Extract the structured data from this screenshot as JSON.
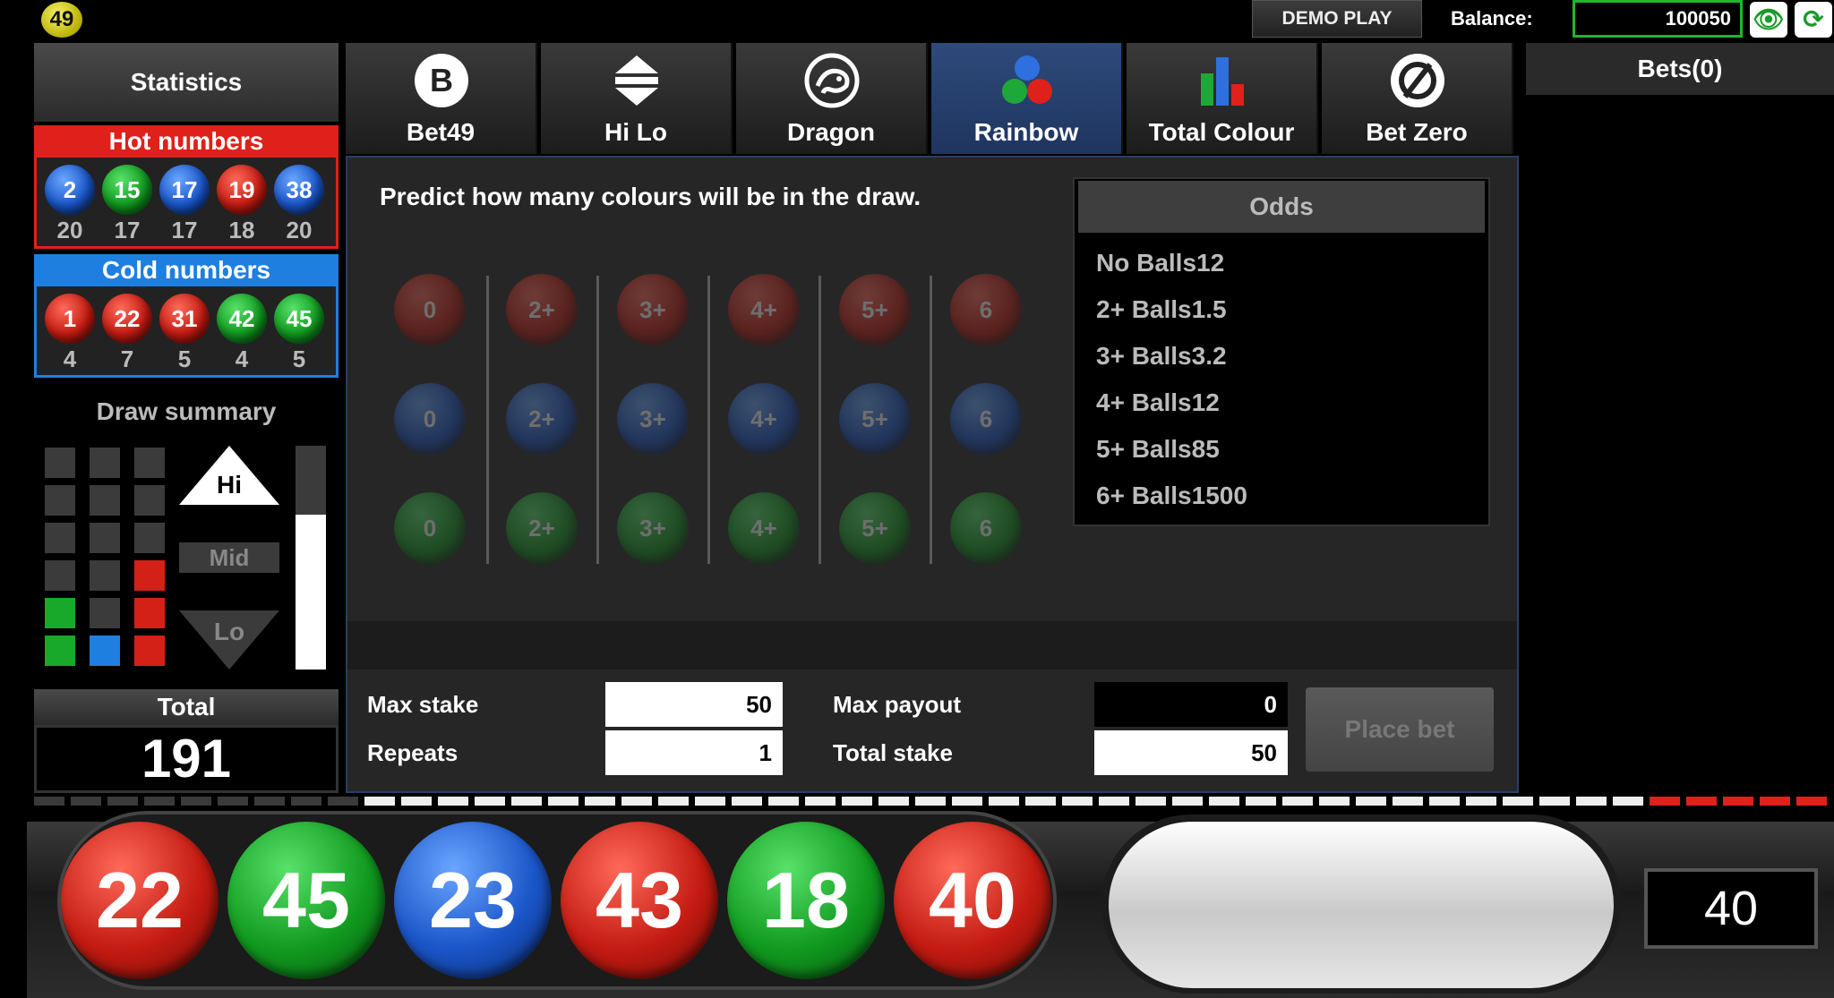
{
  "topbar": {
    "logo": "49",
    "demo": "DEMO PLAY",
    "balance_label": "Balance:",
    "balance_value": "100050",
    "icons": [
      "eye-icon",
      "refresh-icon"
    ]
  },
  "stats": {
    "tab_label": "Statistics",
    "hot_title": "Hot numbers",
    "hot": [
      {
        "num": "2",
        "color": "blue",
        "count": "20"
      },
      {
        "num": "15",
        "color": "green",
        "count": "17"
      },
      {
        "num": "17",
        "color": "blue",
        "count": "17"
      },
      {
        "num": "19",
        "color": "red",
        "count": "18"
      },
      {
        "num": "38",
        "color": "blue",
        "count": "20"
      }
    ],
    "cold_title": "Cold numbers",
    "cold": [
      {
        "num": "1",
        "color": "red",
        "count": "4"
      },
      {
        "num": "22",
        "color": "red",
        "count": "7"
      },
      {
        "num": "31",
        "color": "red",
        "count": "5"
      },
      {
        "num": "42",
        "color": "green",
        "count": "4"
      },
      {
        "num": "45",
        "color": "green",
        "count": "5"
      }
    ],
    "hot_color": "#e0201a",
    "cold_color": "#1e7fe0"
  },
  "draw_summary": {
    "title": "Draw summary",
    "grid": [
      [
        "",
        "",
        ""
      ],
      [
        "",
        "",
        ""
      ],
      [
        "",
        "",
        ""
      ],
      [
        "",
        "",
        "r"
      ],
      [
        "g",
        "",
        "r"
      ],
      [
        "g",
        "b",
        "r"
      ]
    ],
    "hi": "Hi",
    "mid": "Mid",
    "lo": "Lo",
    "level": 0.69
  },
  "total": {
    "label": "Total",
    "value": "191"
  },
  "tabs": [
    {
      "label": "Bet49",
      "icon": "b-letter-icon",
      "active": false
    },
    {
      "label": "Hi Lo",
      "icon": "hilo-arrows-icon",
      "active": false
    },
    {
      "label": "Dragon",
      "icon": "dragon-icon",
      "active": false
    },
    {
      "label": "Rainbow",
      "icon": "three-balls-icon",
      "active": true
    },
    {
      "label": "Total Colour",
      "icon": "bar-chart-icon",
      "active": false
    },
    {
      "label": "Bet Zero",
      "icon": "zero-slash-icon",
      "active": false
    }
  ],
  "rainbow": {
    "instruction": "Predict how many colours will be in the draw.",
    "options": [
      "0",
      "2+",
      "3+",
      "4+",
      "5+",
      "6"
    ],
    "rows": [
      "red",
      "blue",
      "green"
    ]
  },
  "odds": {
    "title": "Odds",
    "rows": [
      "No Balls12",
      "2+ Balls1.5",
      "3+ Balls3.2",
      "4+ Balls12",
      "5+ Balls85",
      "6+ Balls1500"
    ]
  },
  "form": {
    "max_stake_label": "Max stake",
    "max_stake_value": "50",
    "repeats_label": "Repeats",
    "repeats_value": "1",
    "max_payout_label": "Max payout",
    "max_payout_value": "0",
    "total_stake_label": "Total stake",
    "total_stake_value": "50",
    "place_bet": "Place bet"
  },
  "bets": {
    "title": "Bets(0)"
  },
  "progress": {
    "drawn": 40,
    "total": 49
  },
  "draw_balls": [
    {
      "num": "22",
      "color": "red"
    },
    {
      "num": "45",
      "color": "green"
    },
    {
      "num": "23",
      "color": "blue"
    },
    {
      "num": "43",
      "color": "red"
    },
    {
      "num": "18",
      "color": "green"
    },
    {
      "num": "40",
      "color": "red"
    }
  ],
  "last_number": "40"
}
